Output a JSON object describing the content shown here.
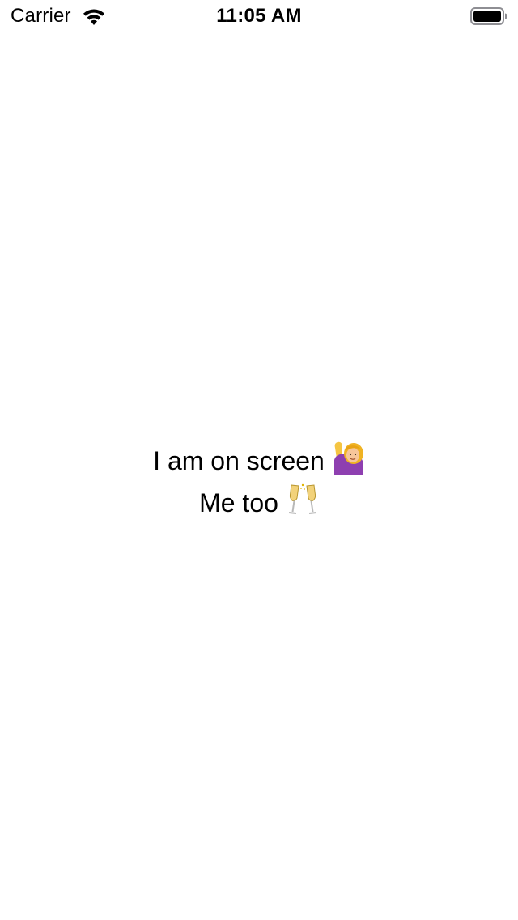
{
  "status_bar": {
    "carrier": "Carrier",
    "time": "11:05 AM",
    "wifi_icon": "wifi-icon",
    "battery_icon": "battery-icon"
  },
  "content": {
    "line1_text": "I am on screen",
    "line1_emoji": "person-raising-hand-emoji",
    "line2_text": "Me too",
    "line2_emoji": "clinking-glasses-emoji"
  },
  "colors": {
    "background": "#ffffff",
    "text": "#000000"
  }
}
